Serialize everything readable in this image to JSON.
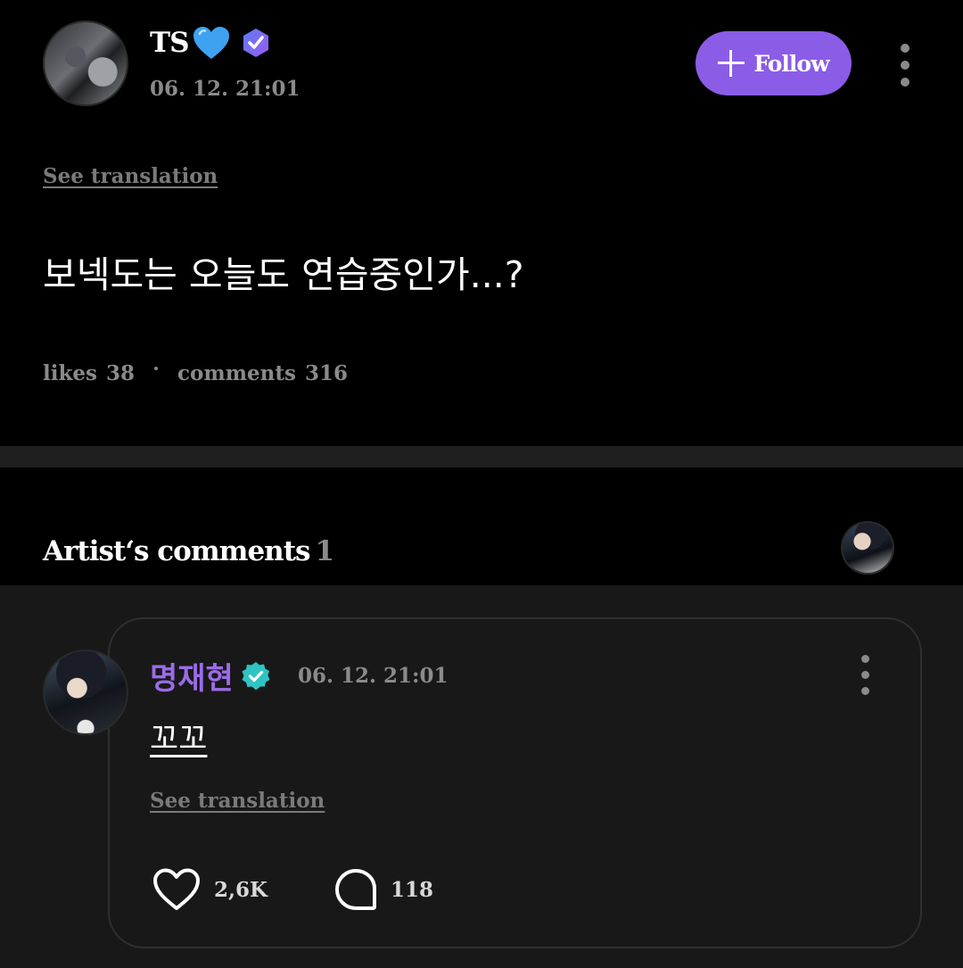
{
  "post": {
    "author": "TS",
    "heart_emoji": "blue-heart",
    "timestamp": "06. 12. 21:01",
    "follow_label": "Follow",
    "see_translation": "See translation",
    "body": "보넥도는 오늘도 연습중인가...?",
    "likes_label": "likes",
    "likes_count": "38",
    "comments_label": "comments",
    "comments_count": "316"
  },
  "artist_comments": {
    "title": "Artist‘s comments",
    "count": "1"
  },
  "comment": {
    "author": "명재현",
    "timestamp": "06. 12. 21:01",
    "text": "꼬꼬",
    "see_translation": "See translation",
    "likes": "2,6K",
    "replies": "118"
  },
  "colors": {
    "accent": "#8b5ce6",
    "name_purple": "#9b6be8",
    "verified_teal": "#2ec4c4",
    "muted": "#8a8a8a"
  }
}
